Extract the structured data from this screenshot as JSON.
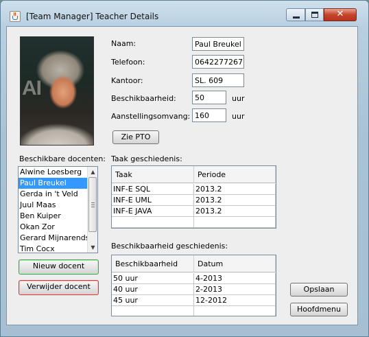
{
  "window": {
    "title": "[Team Manager] Teacher Details"
  },
  "photo": {
    "background_letters": "AI"
  },
  "form": {
    "naam_label": "Naam:",
    "naam_value": "Paul Breukel",
    "telefoon_label": "Telefoon:",
    "telefoon_value": "0642277267",
    "kantoor_label": "Kantoor:",
    "kantoor_value": "SL. 609",
    "beschikbaarheid_label": "Beschikbaarheid:",
    "beschikbaarheid_value": "50",
    "beschikbaarheid_unit": "uur",
    "aanstelling_label": "Aanstellingsomvang:",
    "aanstelling_value": "160",
    "aanstelling_unit": "uur",
    "zie_pto_label": "Zie PTO"
  },
  "docenten": {
    "label": "Beschikbare docenten:",
    "items": [
      "Alwine Loesberg",
      "Paul Breukel",
      "Gerda in 't Veld",
      "Juul Maas",
      "Ben Kuiper",
      "Okan Zor",
      "Gerard Mijnarends",
      "Tim Cocx"
    ],
    "selected_index": 1,
    "nieuw_label": "Nieuw docent",
    "verwijder_label": "Verwijder docent"
  },
  "taak": {
    "label": "Taak geschiedenis:",
    "headers": [
      "Taak",
      "Periode"
    ],
    "rows": [
      [
        "INF-E SQL",
        "2013.2"
      ],
      [
        "INF-E UML",
        "2013.2"
      ],
      [
        "INF-E JAVA",
        "2013.2"
      ]
    ]
  },
  "beschikbaarheid": {
    "label": "Beschikbaarheid geschiedenis:",
    "headers": [
      "Beschikbaarheid",
      "Datum"
    ],
    "rows": [
      [
        "50 uur",
        "4-2013"
      ],
      [
        "40 uur",
        "2-2013"
      ],
      [
        "45 uur",
        "12-2012"
      ]
    ]
  },
  "actions": {
    "opslaan_label": "Opslaan",
    "hoofdmenu_label": "Hoofdmenu"
  }
}
